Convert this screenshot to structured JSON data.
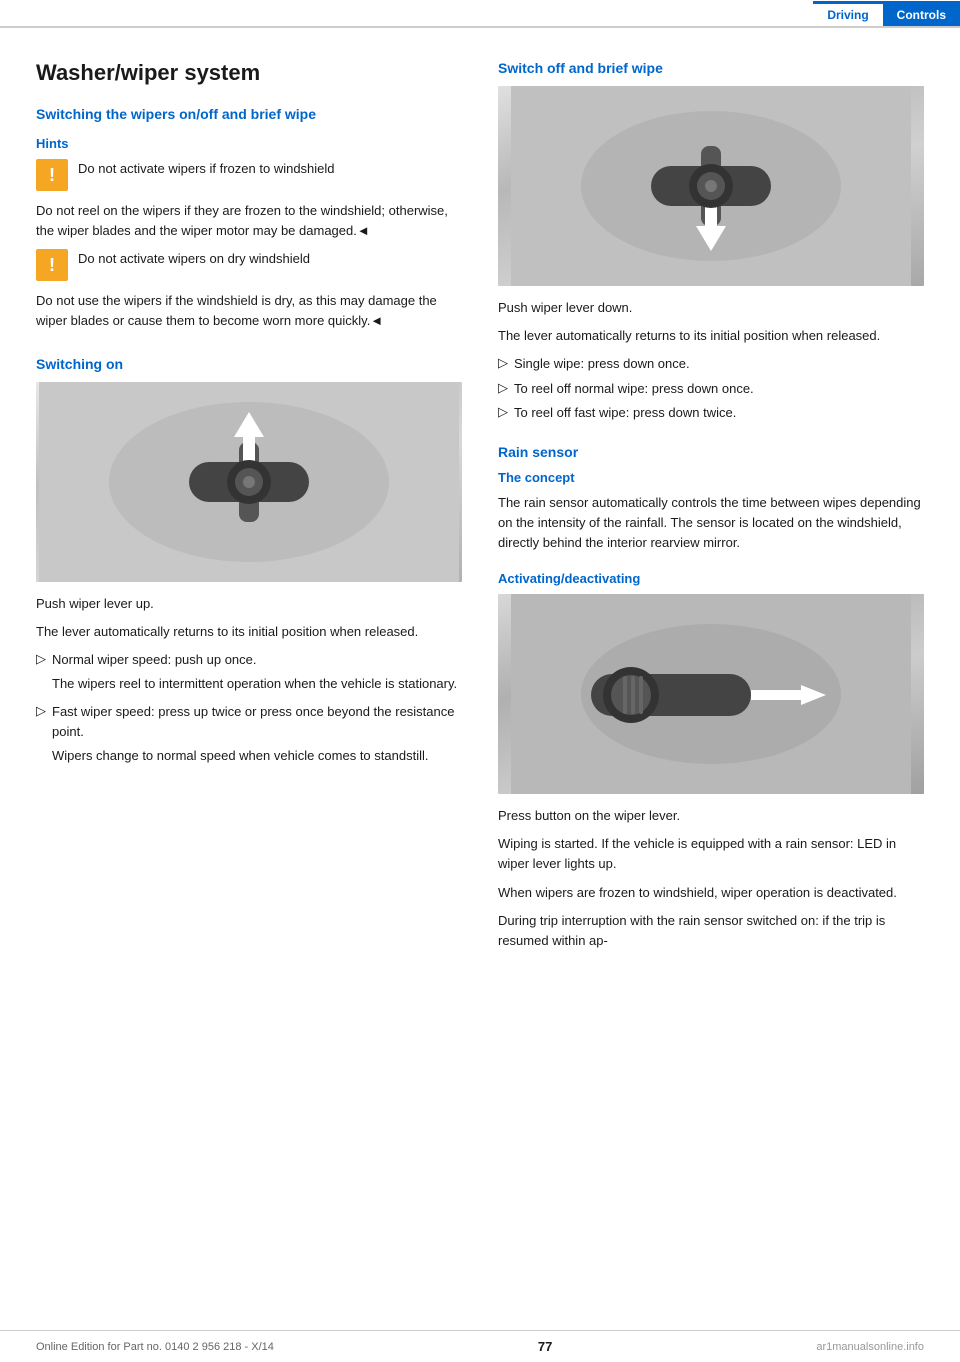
{
  "header": {
    "driving_label": "Driving",
    "controls_label": "Controls"
  },
  "left": {
    "page_title": "Washer/wiper system",
    "section1": {
      "title": "Switching the wipers on/off and brief wipe",
      "hints_title": "Hints",
      "hint1_text": "Do not activate wipers if frozen to windshield",
      "hint1_body": "Do not reel on the wipers if they are frozen to the windshield; otherwise, the wiper blades and the wiper motor may be damaged.◄",
      "hint2_text": "Do not activate wipers on dry windshield",
      "hint2_body": "Do not use the wipers if the windshield is dry, as this may damage the wiper blades or cause them to become worn more quickly.◄"
    },
    "section2": {
      "title": "Switching on",
      "push_lever_up": "Push wiper lever up.",
      "lever_returns": "The lever automatically returns to its initial position when released.",
      "bullets": [
        {
          "text": "Normal wiper speed: push up once.",
          "sub": "The wipers reel to intermittent operation when the vehicle is stationary."
        },
        {
          "text": "Fast wiper speed: press up twice or press once beyond the resistance point.",
          "sub": "Wipers change to normal speed when vehicle comes to standstill."
        }
      ]
    }
  },
  "right": {
    "section1": {
      "title": "Switch off and brief wipe",
      "push_lever_down": "Push wiper lever down.",
      "lever_returns": "The lever automatically returns to its initial position when released.",
      "bullets": [
        "Single wipe: press down once.",
        "To reel off normal wipe: press down once.",
        "To reel off fast wipe: press down twice."
      ]
    },
    "section2": {
      "title": "Rain sensor",
      "concept_title": "The concept",
      "concept_body": "The rain sensor automatically controls the time between wipes depending on the intensity of the rainfall. The sensor is located on the windshield, directly behind the interior rearview mirror.",
      "activating_title": "Activating/deactivating",
      "press_button": "Press button on the wiper lever.",
      "wiping_started": "Wiping is started. If the vehicle is equipped with a rain sensor: LED in wiper lever lights up.",
      "frozen_text": "When wipers are frozen to windshield, wiper operation is deactivated.",
      "trip_interruption": "During trip interruption with the rain sensor switched on: if the trip is resumed within ap-"
    }
  },
  "footer": {
    "online_edition": "Online Edition for Part no. 0140 2 956 218 - X/14",
    "page_number": "77",
    "watermark": "ar1manualsonline.info"
  }
}
